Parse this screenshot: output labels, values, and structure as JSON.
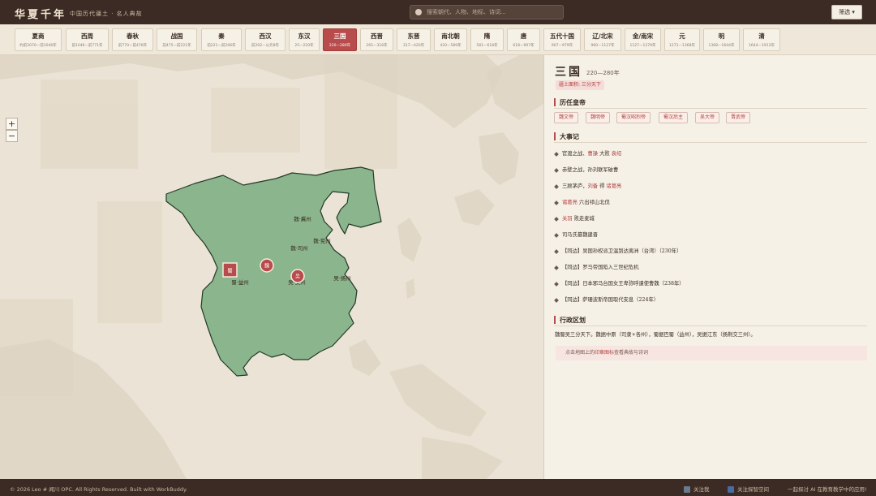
{
  "header": {
    "brand": "华夏千年",
    "tagline": "中国历代疆土 · 名人典故",
    "search_placeholder": "搜索朝代、人物、地标、诗词...",
    "filter_label": "筛选 ▾",
    "search_icon": "search-icon"
  },
  "dynasties": [
    {
      "name": "夏商",
      "years": "约前2070—前1046年"
    },
    {
      "name": "西周",
      "years": "前1046—前771年"
    },
    {
      "name": "春秋",
      "years": "前770—前476年"
    },
    {
      "name": "战国",
      "years": "前475—前221年"
    },
    {
      "name": "秦",
      "years": "前221—前206年"
    },
    {
      "name": "西汉",
      "years": "前202—公元8年"
    },
    {
      "name": "东汉",
      "years": "25—220年"
    },
    {
      "name": "三国",
      "years": "220—280年"
    },
    {
      "name": "西晋",
      "years": "265—316年"
    },
    {
      "name": "东晋",
      "years": "317—420年"
    },
    {
      "name": "南北朝",
      "years": "420—589年"
    },
    {
      "name": "隋",
      "years": "581—618年"
    },
    {
      "name": "唐",
      "years": "618—907年"
    },
    {
      "name": "五代十国",
      "years": "907—979年"
    },
    {
      "name": "辽/北宋",
      "years": "960—1127年"
    },
    {
      "name": "金/南宋",
      "years": "1127—1279年"
    },
    {
      "name": "元",
      "years": "1271—1368年"
    },
    {
      "name": "明",
      "years": "1368—1644年"
    },
    {
      "name": "清",
      "years": "1644—1912年"
    }
  ],
  "active_dynasty": "三国",
  "map": {
    "zoom_in": "+",
    "zoom_out": "−",
    "labels": [
      "魏·冀州",
      "魏·兖州",
      "魏·司州",
      "蜀·益州",
      "吴·扬州",
      "吴·交州"
    ],
    "markers": [
      "蜀",
      "魏",
      "吴"
    ],
    "territory_color": "#8bb58c",
    "marker_color": "#b84b4b"
  },
  "panel": {
    "title": "三国",
    "years": "220—280年",
    "territory_badge": "疆土面积: 三分天下",
    "emperors_heading": "历任皇帝",
    "emperors": [
      "魏文帝",
      "魏明帝",
      "蜀汉昭烈帝",
      "蜀汉后主",
      "吴大帝",
      "晋武帝"
    ],
    "events_heading": "大事记",
    "events": [
      {
        "pre": "官渡之战、",
        "hl": "曹操",
        "mid": "大败",
        "hl2": "袁绍",
        "post": ""
      },
      {
        "pre": "赤壁之战，孙刘联军破曹",
        "hl": "",
        "mid": "",
        "hl2": "",
        "post": ""
      },
      {
        "pre": "三顾茅庐，",
        "hl": "刘备",
        "mid": "得",
        "hl2": "诸葛亮",
        "post": ""
      },
      {
        "pre": "",
        "hl": "诸葛亮",
        "mid": "六出祁山北伐",
        "hl2": "",
        "post": ""
      },
      {
        "pre": "",
        "hl": "关羽",
        "mid": "败走麦城",
        "hl2": "",
        "post": ""
      },
      {
        "pre": "司马氏篡魏建晋",
        "hl": "",
        "mid": "",
        "hl2": "",
        "post": ""
      },
      {
        "pre": "【同边】吴国孙权派卫温到达夷洲（台湾）（230年）",
        "hl": "",
        "mid": "",
        "hl2": "",
        "post": ""
      },
      {
        "pre": "【同边】罗马帝国陷入三世纪危机",
        "hl": "",
        "mid": "",
        "hl2": "",
        "post": ""
      },
      {
        "pre": "【同边】日本邪马台国女王卑弥呼遣使曹魏（238年）",
        "hl": "",
        "mid": "",
        "hl2": "",
        "post": ""
      },
      {
        "pre": "【同边】萨珊波斯帝国取代安息（224年）",
        "hl": "",
        "mid": "",
        "hl2": "",
        "post": ""
      }
    ],
    "admin_heading": "行政区划",
    "admin_text": "魏蜀吴三分天下。魏据中原（司隶+各州），蜀据巴蜀（益州），吴据江东（扬荆交三州）。",
    "hint_pre": "点击地图上的",
    "hint_hl": "印章图标",
    "hint_post": "查看典故与诗词"
  },
  "footer": {
    "copyright": "© 2026 Leo # 闻川 OPC. All Rights Reserved. Built with WorkBuddy.",
    "link1": "关注我",
    "link2": "关注探智空间",
    "right": "一起探讨 AI 在教育教学中的应用!"
  }
}
